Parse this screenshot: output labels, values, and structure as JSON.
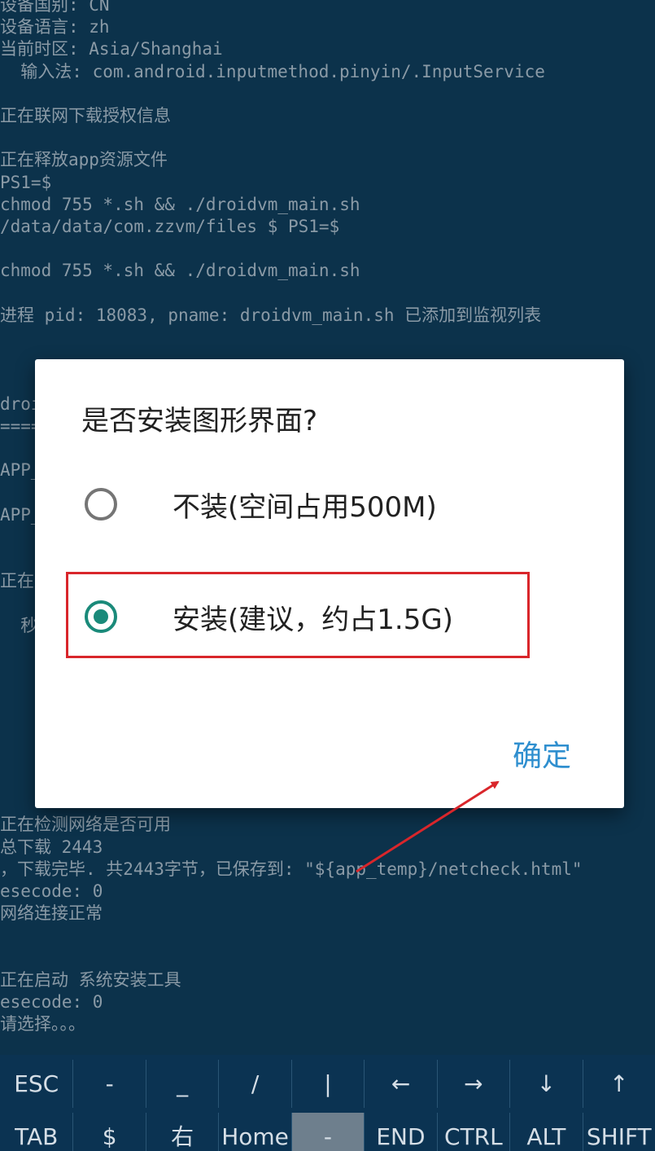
{
  "terminal": {
    "lines": [
      "设备国别: CN",
      "设备语言: zh",
      "当前时区: Asia/Shanghai",
      "  输入法: com.android.inputmethod.pinyin/.InputService",
      "",
      "正在联网下载授权信息",
      "",
      "正在释放app资源文件",
      "PS1=$",
      "chmod 755 *.sh && ./droidvm_main.sh",
      "/data/data/com.zzvm/files $ PS1=$",
      "",
      "chmod 755 *.sh && ./droidvm_main.sh",
      "",
      "进程 pid: 18083, pname: droidvm_main.sh 已添加到监视列表",
      "",
      "",
      "",
      "droi",
      "====",
      "",
      "APP_",
      "",
      "APP_",
      "",
      "",
      "正在复",
      "",
      "  秒内",
      "",
      "",
      "",
      "",
      "",
      "",
      "",
      "",
      "正在检测网络是否可用",
      "总下载 2443",
      "，下载完毕. 共2443字节，已保存到: \"${app_temp}/netcheck.html\"",
      "esecode: 0",
      "网络连接正常",
      "",
      "",
      "正在启动 系统安装工具",
      "esecode: 0",
      "请选择。。。"
    ]
  },
  "dialog": {
    "title": "是否安装图形界面?",
    "options": [
      {
        "label": "不装(空间占用500M)",
        "selected": false
      },
      {
        "label": "安装(建议，约占1.5G)",
        "selected": true
      }
    ],
    "confirm_label": "确定",
    "accent_color": "#1a8a7a",
    "button_color": "#2f8fcf",
    "annotation_color": "#d9262b"
  },
  "extra_keys": {
    "row1": [
      "ESC",
      "-",
      "_",
      "/",
      "|",
      "←",
      "→",
      "↓",
      "↑"
    ],
    "row2": [
      "TAB",
      "$",
      "右",
      "Home",
      "-",
      "END",
      "CTRL",
      "ALT",
      "SHIFT"
    ]
  }
}
